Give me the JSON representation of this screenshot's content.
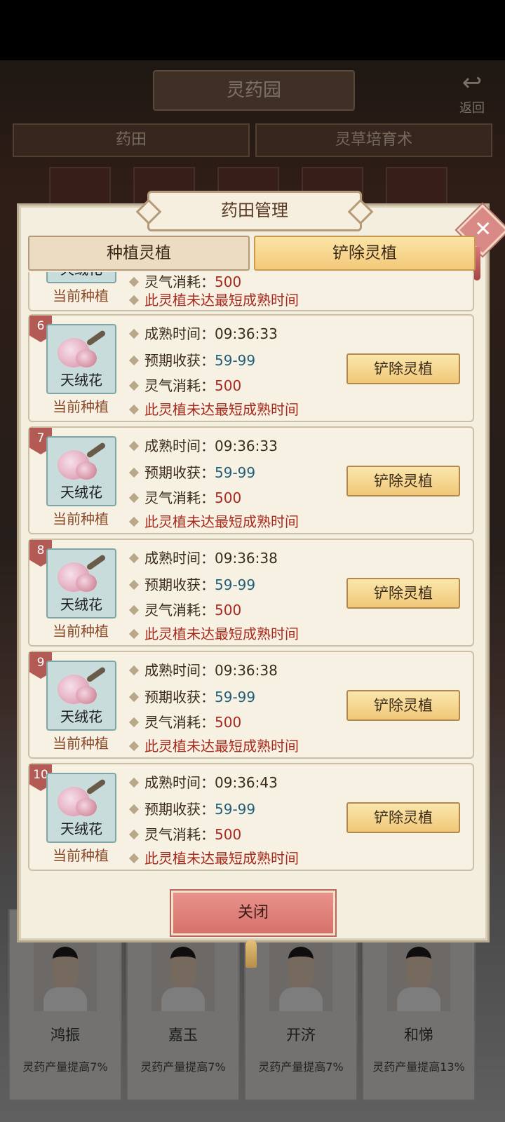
{
  "background": {
    "title": "灵药园",
    "back_label": "返回",
    "tabs": [
      "药田",
      "灵草培育术"
    ],
    "heroes": [
      {
        "name": "鸿振",
        "bonus": "灵药产量提高7%"
      },
      {
        "name": "嘉玉",
        "bonus": "灵药产量提高7%"
      },
      {
        "name": "开济",
        "bonus": "灵药产量提高7%"
      },
      {
        "name": "和悌",
        "bonus": "灵药产量提高13%"
      }
    ]
  },
  "modal": {
    "title": "药田管理",
    "tabs": {
      "plant": "种植灵植",
      "remove": "铲除灵植"
    },
    "active_tab": "remove",
    "close_button": "关闭",
    "close_icon": "✕"
  },
  "plots_partial": {
    "qi_label": "灵气消耗：",
    "qi_value": "500",
    "status": "当前种植",
    "plant_name": "天绒花",
    "warning": "此灵植未达最短成熟时间"
  },
  "plots": [
    {
      "index": "6",
      "plant_name": "天绒花",
      "status": "当前种植",
      "mature_label": "成熟时间：",
      "mature_time": "09:36:33",
      "yield_label": "预期收获：",
      "yield": "59-99",
      "qi_label": "灵气消耗：",
      "qi": "500",
      "warning": "此灵植未达最短成熟时间",
      "button": "铲除灵植"
    },
    {
      "index": "7",
      "plant_name": "天绒花",
      "status": "当前种植",
      "mature_label": "成熟时间：",
      "mature_time": "09:36:33",
      "yield_label": "预期收获：",
      "yield": "59-99",
      "qi_label": "灵气消耗：",
      "qi": "500",
      "warning": "此灵植未达最短成熟时间",
      "button": "铲除灵植"
    },
    {
      "index": "8",
      "plant_name": "天绒花",
      "status": "当前种植",
      "mature_label": "成熟时间：",
      "mature_time": "09:36:38",
      "yield_label": "预期收获：",
      "yield": "59-99",
      "qi_label": "灵气消耗：",
      "qi": "500",
      "warning": "此灵植未达最短成熟时间",
      "button": "铲除灵植"
    },
    {
      "index": "9",
      "plant_name": "天绒花",
      "status": "当前种植",
      "mature_label": "成熟时间：",
      "mature_time": "09:36:38",
      "yield_label": "预期收获：",
      "yield": "59-99",
      "qi_label": "灵气消耗：",
      "qi": "500",
      "warning": "此灵植未达最短成熟时间",
      "button": "铲除灵植"
    },
    {
      "index": "10",
      "plant_name": "天绒花",
      "status": "当前种植",
      "mature_label": "成熟时间：",
      "mature_time": "09:36:43",
      "yield_label": "预期收获：",
      "yield": "59-99",
      "qi_label": "灵气消耗：",
      "qi": "500",
      "warning": "此灵植未达最短成熟时间",
      "button": "铲除灵植"
    }
  ],
  "colors": {
    "accent_red": "#a82a1e",
    "accent_blue": "#1f5f7a",
    "button_gold": "#f4c97a",
    "close_pink": "#d6716b"
  }
}
